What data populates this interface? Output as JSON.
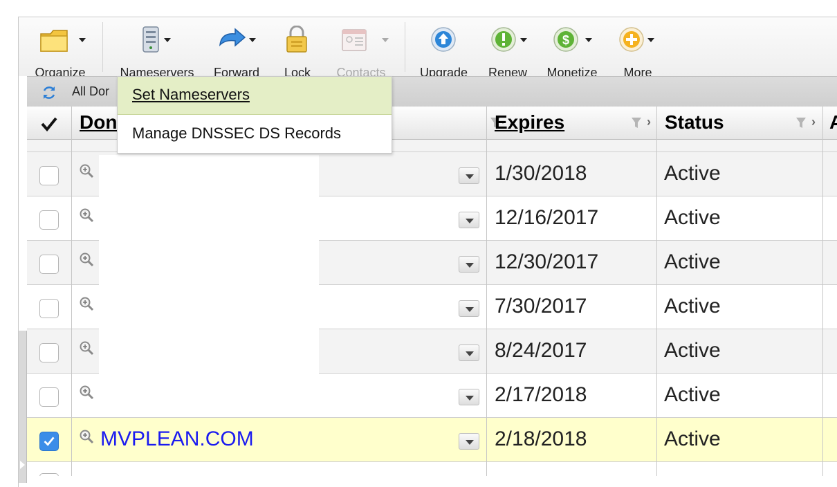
{
  "toolbar": {
    "buttons": [
      {
        "label": "Organize",
        "icon": "folder-icon",
        "enabled": true
      },
      {
        "label": "Nameservers",
        "icon": "server-icon",
        "enabled": true
      },
      {
        "label": "Forward",
        "icon": "forward-arrow-icon",
        "enabled": true
      },
      {
        "label": "Lock",
        "icon": "padlock-icon",
        "enabled": true
      },
      {
        "label": "Contacts",
        "icon": "contact-card-icon",
        "enabled": false
      },
      {
        "label": "Upgrade",
        "icon": "up-arrow-circle-icon",
        "enabled": true
      },
      {
        "label": "Renew",
        "icon": "exclamation-circle-icon",
        "enabled": true
      },
      {
        "label": "Monetize",
        "icon": "dollar-circle-icon",
        "enabled": true
      },
      {
        "label": "More",
        "icon": "plus-circle-icon",
        "enabled": true
      }
    ]
  },
  "strip": {
    "label": "All Dor"
  },
  "columns": {
    "domain": "Don",
    "expires": "Expires",
    "status": "Status",
    "next": "A"
  },
  "menu": {
    "items": [
      {
        "label": "Set Nameservers",
        "active": true
      },
      {
        "label": "Manage DNSSEC DS Records",
        "active": false
      }
    ]
  },
  "rows": [
    {
      "domain": "",
      "expires": "1/30/2018",
      "status": "Active",
      "checked": false
    },
    {
      "domain": "",
      "expires": "12/16/2017",
      "status": "Active",
      "checked": false
    },
    {
      "domain": "",
      "expires": "12/30/2017",
      "status": "Active",
      "checked": false
    },
    {
      "domain": "",
      "expires": "7/30/2017",
      "status": "Active",
      "checked": false
    },
    {
      "domain": "",
      "expires": "8/24/2017",
      "status": "Active",
      "checked": false
    },
    {
      "domain": "",
      "expires": "2/17/2018",
      "status": "Active",
      "checked": false
    },
    {
      "domain": "MVPLEAN.COM",
      "expires": "2/18/2018",
      "status": "Active",
      "checked": true
    }
  ],
  "colors": {
    "link": "#1a1af0",
    "selected_row": "#ffffcc",
    "menu_highlight": "#e4eec6",
    "checkbox_checked": "#3b8de8"
  }
}
